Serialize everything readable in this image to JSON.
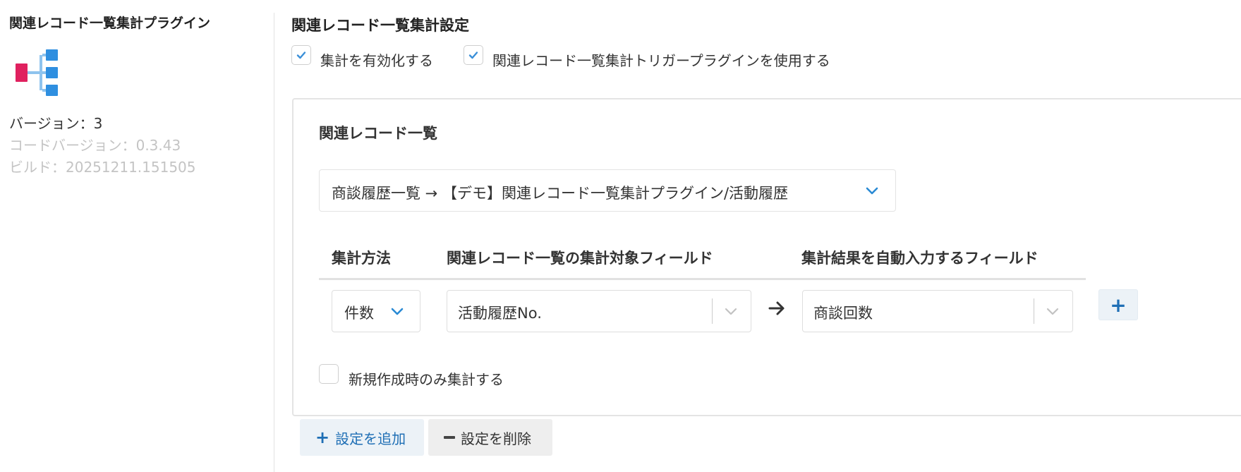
{
  "plugin": {
    "name": "関連レコード一覧集計プラグイン",
    "version": "バージョン：3",
    "code_version": "コードバージョン：0.3.43",
    "build": "ビルド：20251211.151505",
    "logo_icon": "hierarchy-icon"
  },
  "settings": {
    "title": "関連レコード一覧集計設定",
    "enable_aggregation": {
      "label": "集計を有効化する",
      "checked": true
    },
    "use_trigger_plugin": {
      "label": "関連レコード一覧集計トリガープラグインを使用する",
      "checked": true
    }
  },
  "card": {
    "heading": "関連レコード一覧",
    "related_list_select": "商談履歴一覧 → 【デモ】関連レコード一覧集計プラグイン/活動履歴",
    "table": {
      "headers": [
        "集計方法",
        "関連レコード一覧の集計対象フィールド",
        "集計結果を自動入力するフィールド"
      ],
      "rows": [
        {
          "method": "件数",
          "target_field": "活動履歴No.",
          "result_field": "商談回数"
        }
      ]
    },
    "add_row_button": "+",
    "only_on_create": {
      "label": "新規作成時のみ集計する",
      "checked": false
    }
  },
  "buttons": {
    "add_setting": "設定を追加",
    "delete_setting": "設定を削除"
  },
  "colors": {
    "accent": "#1f6fb5",
    "check": "#3a8fd8",
    "logo_pink": "#e0215f",
    "logo_blue": "#2f8fe0",
    "logo_light_blue": "#8ec3ee"
  }
}
